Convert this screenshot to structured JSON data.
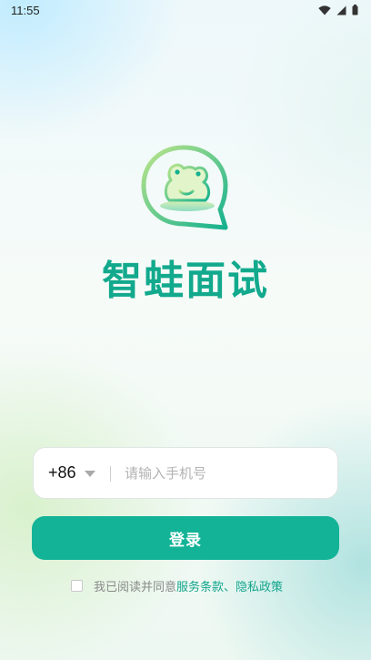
{
  "status_bar": {
    "time": "11:55"
  },
  "app": {
    "title": "智蛙面试"
  },
  "login_form": {
    "country_code": "+86",
    "phone_placeholder": "请输入手机号",
    "phone_value": "",
    "login_label": "登录",
    "agreement_prefix": "我已阅读并同意",
    "terms_link": "服务条款",
    "separator": "、",
    "privacy_link": "隐私政策",
    "agreed": false
  },
  "colors": {
    "brand": "#13b397",
    "title": "#12a98d",
    "link": "#13a58c"
  },
  "icons": [
    "wifi-icon",
    "signal-icon",
    "battery-icon",
    "frog-chat-logo-icon",
    "dropdown-caret-icon"
  ]
}
